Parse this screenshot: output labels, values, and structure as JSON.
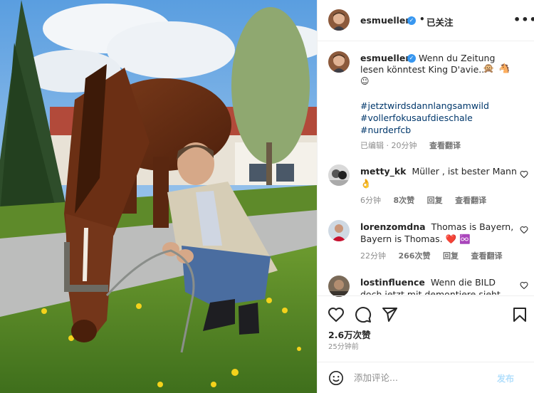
{
  "post": {
    "username": "esmuellert",
    "dot": "•",
    "follow_label": "已关注",
    "more_label": "•••"
  },
  "caption": {
    "username": "esmuellert",
    "text_line1": "Wenn du Zeitung",
    "text_line2": "lesen könntest King D'avie...",
    "emoji1": "🙊",
    "emoji2": "🐴",
    "smile": "☺",
    "hashtags": [
      "#jetztwirdsdannlangsamwild",
      "#vollerfokusaufdieschale",
      "#nurderfcb"
    ],
    "edited": "已编辑",
    "time": "20分钟",
    "translate": "查看翻译"
  },
  "comments": [
    {
      "username": "metty_kk",
      "text": "Müller , ist bester Mann",
      "emoji": "👌",
      "time": "6分钟",
      "likes": "8次赞",
      "reply": "回复",
      "translate": "查看翻译"
    },
    {
      "username": "lorenzomdna",
      "text": "Thomas is Bayern, Bayern is Thomas.",
      "emoji": "❤️ ♾️",
      "time": "22分钟",
      "likes": "266次赞",
      "reply": "回复",
      "translate": "查看翻译"
    },
    {
      "username": "lostinfluence",
      "text": "Wenn die BILD doch jetzt mit demontiere sieht"
    }
  ],
  "stats": {
    "likes": "2.6万次赞",
    "posted": "25分钟前"
  },
  "comment_box": {
    "placeholder": "添加评论...",
    "post_label": "发布"
  },
  "colors": {
    "verified": "#3897f0",
    "hashtag": "#00376b",
    "meta": "#8e8e8e",
    "post_button": "#b2dffc"
  },
  "icons": [
    "heart-icon",
    "comment-icon",
    "share-icon",
    "bookmark-icon",
    "emoji-icon",
    "more-icon",
    "verified-icon"
  ]
}
